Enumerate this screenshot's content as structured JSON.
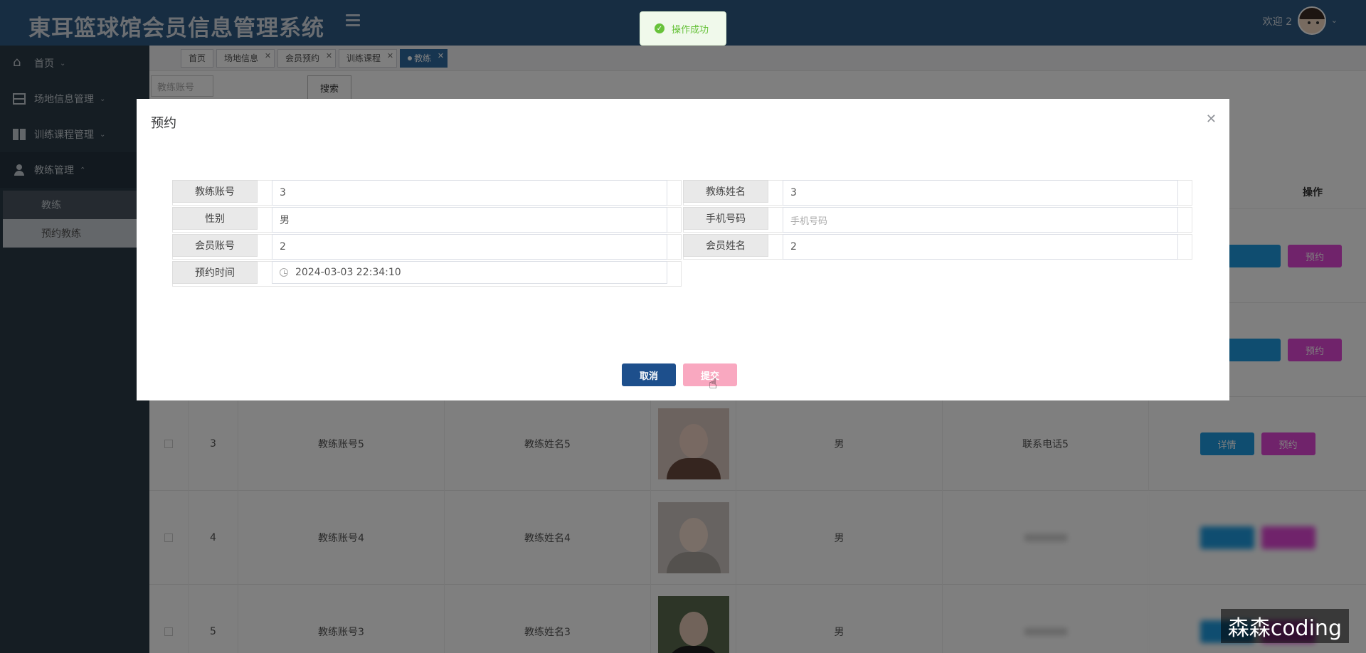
{
  "header": {
    "app_title": "東耳篮球馆会员信息管理系统",
    "welcome": "欢迎 2"
  },
  "toast": {
    "message": "操作成功"
  },
  "sidebar": {
    "items": [
      {
        "label": "首页",
        "icon": "home-icon"
      },
      {
        "label": "场地信息管理",
        "icon": "grid-icon"
      },
      {
        "label": "训练课程管理",
        "icon": "dashboard-icon"
      },
      {
        "label": "教练管理",
        "icon": "user-icon"
      }
    ],
    "sub_items": [
      {
        "label": "教练"
      },
      {
        "label": "预约教练"
      }
    ]
  },
  "tabs": [
    {
      "label": "首页"
    },
    {
      "label": "场地信息"
    },
    {
      "label": "会员预约"
    },
    {
      "label": "训练课程"
    },
    {
      "label": "教练"
    }
  ],
  "search": {
    "placeholder": "教练账号",
    "button": "搜索"
  },
  "table": {
    "header_action": "操作",
    "rows": [
      {
        "index": "3",
        "account": "教练账号5",
        "name": "教练姓名5",
        "gender": "男",
        "phone": "联系电话5",
        "detail": "详情",
        "book": "预约"
      },
      {
        "index": "4",
        "account": "教练账号4",
        "name": "教练姓名4",
        "gender": "男",
        "phone": "",
        "detail": "",
        "book": ""
      },
      {
        "index": "5",
        "account": "教练账号3",
        "name": "教练姓名3",
        "gender": "男",
        "phone": "",
        "detail": "",
        "book": ""
      }
    ],
    "hidden_row_book_label": "预约"
  },
  "dialog": {
    "title": "预约",
    "fields": {
      "coach_account_label": "教练账号",
      "coach_account": "3",
      "coach_name_label": "教练姓名",
      "coach_name": "3",
      "gender_label": "性别",
      "gender": "男",
      "phone_label": "手机号码",
      "phone_placeholder": "手机号码",
      "member_account_label": "会员账号",
      "member_account": "2",
      "member_name_label": "会员姓名",
      "member_name": "2",
      "booking_time_label": "预约时间",
      "booking_time": "2024-03-03 22:34:10"
    },
    "cancel": "取消",
    "submit": "提交"
  },
  "watermark": "森森coding",
  "colors": {
    "header_bg": "#2e5b85",
    "sidebar_bg": "#2b3a47",
    "detail_btn": "#1e9be0",
    "book_btn": "#e046d6",
    "cancel_btn": "#1d4f8c",
    "submit_btn": "#f9a8c0",
    "toast_success": "#67c23a"
  }
}
